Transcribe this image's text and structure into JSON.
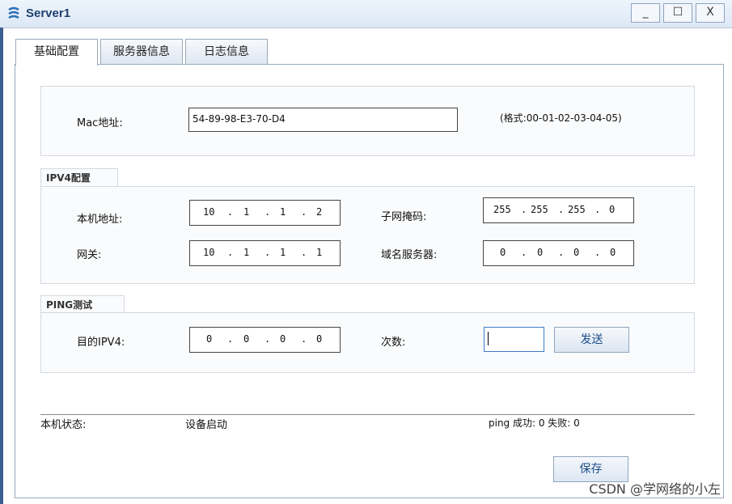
{
  "window": {
    "title": "Server1",
    "minimize": "_",
    "maximize": "☐",
    "close": "X"
  },
  "tabs": [
    "基础配置",
    "服务器信息",
    "日志信息"
  ],
  "mac": {
    "label": "Mac地址:",
    "value": "54-89-98-E3-70-D4",
    "format_hint": "(格式:00-01-02-03-04-05)"
  },
  "ipv4": {
    "section_title": "IPV4配置",
    "local_addr_label": "本机地址:",
    "local_addr": [
      "10",
      "1",
      "1",
      "2"
    ],
    "mask_label": "子网掩码:",
    "mask": [
      "255",
      "255",
      "255",
      "0"
    ],
    "gateway_label": "网关:",
    "gateway": [
      "10",
      "1",
      "1",
      "1"
    ],
    "dns_label": "域名服务器:",
    "dns": [
      "0",
      "0",
      "0",
      "0"
    ]
  },
  "ping": {
    "section_title": "PING测试",
    "target_label": "目的IPV4:",
    "target": [
      "0",
      "0",
      "0",
      "0"
    ],
    "count_label": "次数:",
    "count_value": "",
    "send_label": "发送"
  },
  "status": {
    "label": "本机状态:",
    "value": "设备启动",
    "ping_result": "ping 成功: 0 失败: 0"
  },
  "save_label": "保存",
  "watermark": "CSDN @学网络的小左"
}
